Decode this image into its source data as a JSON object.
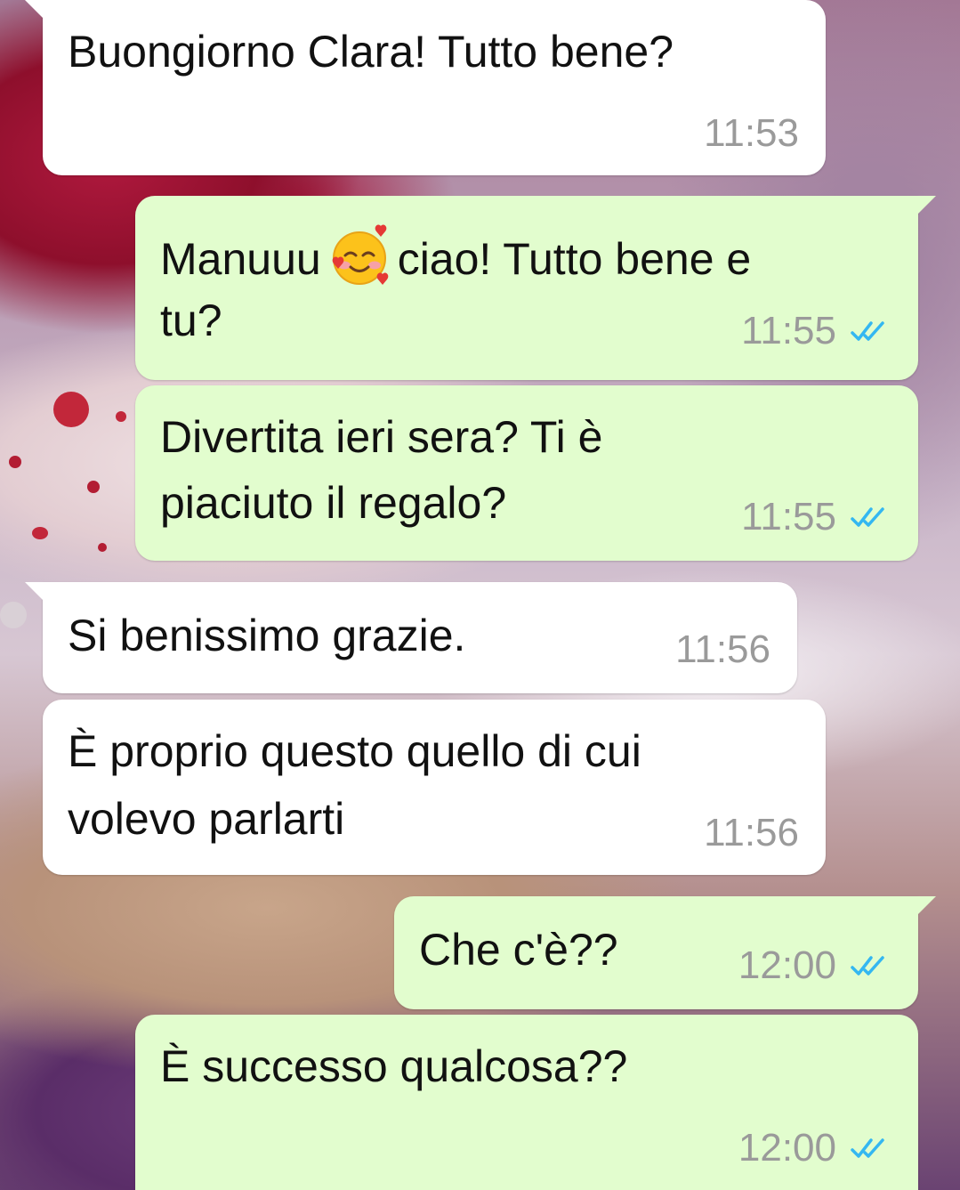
{
  "chat": {
    "messages": [
      {
        "direction": "incoming",
        "lines": [
          "Buongiorno Clara! Tutto bene?"
        ],
        "time": "11:53"
      },
      {
        "direction": "outgoing",
        "line1_before": "Manuuu",
        "line1_emoji": "smiling-face-with-hearts-emoji",
        "line1_after": "ciao! Tutto bene e",
        "line2": "tu?",
        "time": "11:55",
        "status": "read"
      },
      {
        "direction": "outgoing",
        "lines": [
          "Divertita ieri sera? Ti è",
          "piaciuto il regalo?"
        ],
        "time": "11:55",
        "status": "read"
      },
      {
        "direction": "incoming",
        "lines": [
          "Si benissimo grazie."
        ],
        "time": "11:56"
      },
      {
        "direction": "incoming",
        "lines": [
          "È proprio questo quello di cui",
          "volevo parlarti"
        ],
        "time": "11:56"
      },
      {
        "direction": "outgoing",
        "lines": [
          "Che c'è??"
        ],
        "time": "12:00",
        "status": "read"
      },
      {
        "direction": "outgoing",
        "lines": [
          "È successo qualcosa??"
        ],
        "time": "12:00",
        "status": "read"
      }
    ]
  },
  "colors": {
    "incoming_bubble": "#ffffff",
    "outgoing_bubble": "#e2fdce",
    "timestamp": "#9a9a9a",
    "read_tick": "#34b7f1"
  }
}
